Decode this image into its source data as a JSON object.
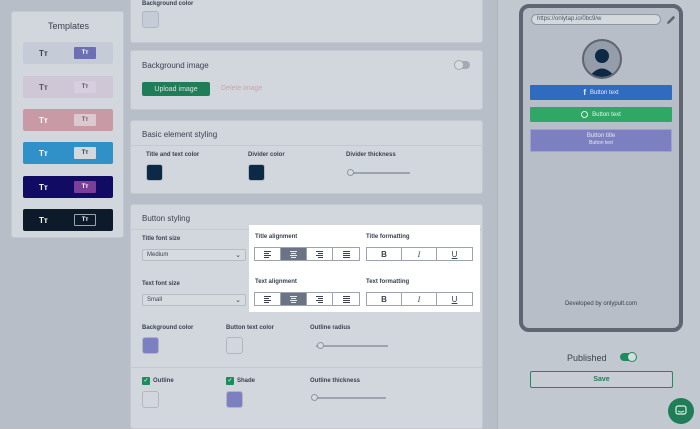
{
  "templates": {
    "title": "Templates",
    "items": [
      {
        "a": "Tт",
        "b": "Tт",
        "bg": "#c5ccd8",
        "ac": "#3c4453",
        "bbg": "#6d6fb3",
        "bc": "#ffffff"
      },
      {
        "a": "Tт",
        "b": "Tт",
        "bg": "#cfc6d6",
        "ac": "#5d5066",
        "bbg": "#d7cfe0",
        "bc": "#5d5066"
      },
      {
        "a": "Tт",
        "b": "Tт",
        "bg": "#c89aa6",
        "ac": "#ffffff",
        "bbg": "#dcc8cf",
        "bc": "#7a5a63"
      },
      {
        "a": "Tт",
        "b": "Tт",
        "bg": "#2f91c7",
        "ac": "#ffffff",
        "bbg": "#d3d8de",
        "bc": "#2a3a4a"
      },
      {
        "a": "Tт",
        "b": "Tт",
        "bg": "#120b63",
        "ac": "#ffffff",
        "bbg": "#7b3f9a",
        "bc": "#ffffff"
      },
      {
        "a": "Tт",
        "b": "Tт",
        "bg": "#0c1a2a",
        "ac": "#ffffff",
        "bbg": "#0c1a2a",
        "bc": "#ffffff"
      }
    ]
  },
  "background_color": {
    "label": "Background color",
    "color": "#c5ccd8"
  },
  "background_image": {
    "title": "Background image",
    "upload_label": "Upload image",
    "delete_label": "Delete image"
  },
  "basic_styling": {
    "title": "Basic element styling",
    "title_text_color_label": "Title and text color",
    "title_text_color": "#0c2a45",
    "divider_color_label": "Divider color",
    "divider_color": "#0c2a45",
    "divider_thickness_label": "Divider thickness",
    "divider_thickness_value": 0
  },
  "button_styling": {
    "title": "Button styling",
    "title_font_size_label": "Title font size",
    "title_font_size": "Medium",
    "title_alignment_label": "Title alignment",
    "title_formatting_label": "Title formatting",
    "text_font_size_label": "Text font size",
    "text_font_size": "Small",
    "text_alignment_label": "Text alignment",
    "text_formatting_label": "Text formatting",
    "format_bold": "B",
    "format_italic": "I",
    "format_underline": "U",
    "background_color_label": "Background color",
    "background_color": "#7d80c0",
    "button_text_color_label": "Button text color",
    "button_text_color": "#d2d7dd",
    "outline_radius_label": "Outline radius",
    "outline_radius_value": 0.05,
    "outline_label": "Outline",
    "shade_label": "Shade",
    "outline_color": "#d2d7dd",
    "shade_color": "#7d80c0",
    "outline_thickness_label": "Outline thickness",
    "outline_thickness_value": 0
  },
  "preview": {
    "url": "https://onlytap.io/0bc9/w",
    "button1": "Button text",
    "button2": "Button text",
    "button3_title": "Button title",
    "button3_text": "Button text",
    "footer": "Developed by onlypult.com"
  },
  "publish": {
    "label": "Published",
    "on": true,
    "save_label": "Save"
  },
  "colors": {
    "green": "#1f8a5e",
    "facebook": "#2f6bbf",
    "whatsapp": "#2ea864",
    "accent": "#7d80c0"
  }
}
